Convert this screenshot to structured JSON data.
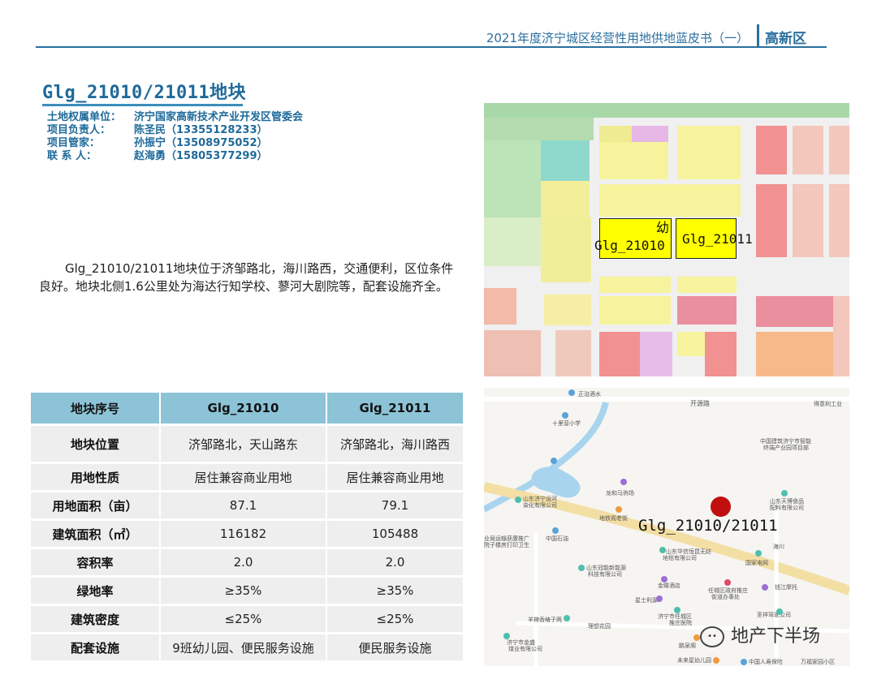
{
  "header": {
    "title": "2021年度济宁城区经营性用地供地蓝皮书（一）",
    "zone": "高新区"
  },
  "plot_title": "Glg_21010/21011地块",
  "contacts": [
    {
      "label": "土地权属单位：",
      "value": "济宁国家高新技术产业开发区管委会"
    },
    {
      "label": "项目负责人：",
      "value": "陈圣民（13355128233）"
    },
    {
      "label": "项目管家：",
      "value": "孙振宁（13508975052）"
    },
    {
      "label": "联 系 人：",
      "value": "赵海勇（15805377299）"
    }
  ],
  "description": "Glg_21010/21011地块位于济邹路北，海川路西，交通便利，区位条件良好。地块北侧1.6公里处为海达行知学校、蓼河大剧院等，配套设施齐全。",
  "table": {
    "headers": [
      "地块序号",
      "Glg_21010",
      "Glg_21011"
    ],
    "rows": [
      [
        "地块位置",
        "济邹路北，天山路东",
        "济邹路北，海川路西"
      ],
      [
        "用地性质",
        "居住兼容商业用地",
        "居住兼容商业用地"
      ],
      [
        "用地面积（亩）",
        "87.1",
        "79.1"
      ],
      [
        "建筑面积（㎡）",
        "116182",
        "105488"
      ],
      [
        "容积率",
        "2.0",
        "2.0"
      ],
      [
        "绿地率",
        "≥35%",
        "≥35%"
      ],
      [
        "建筑密度",
        "≤25%",
        "≤25%"
      ],
      [
        "配套设施",
        "9班幼儿园、便民服务设施",
        "便民服务设施"
      ]
    ]
  },
  "planning_map": {
    "label_a": "Glg_21010",
    "label_b": "Glg_21011",
    "label_kinder": "幼"
  },
  "location_map": {
    "plot_label": "Glg_21010/21011",
    "pois": [
      "正治酒水",
      "开源路",
      "得意利工业",
      "十里营小学",
      "中国建筑济宁市智能",
      "终端产业园项目部",
      "龙和马驹场",
      "山东济宁运河",
      "染化有限公司",
      "山东天博食品",
      "配料有限公司",
      "地铁观老街",
      "中国石油",
      "业局运输获康推广",
      "院子楼房打印卫生",
      "山东华信恒昆无纺",
      "地毯有限公司",
      "国家电网",
      "山东冠能新能源",
      "科技有限公司",
      "金蝶酒店",
      "任城区政府推庄",
      "街道办事处",
      "钱江摩托",
      "星士利源",
      "济宁市任城区",
      "推庄医院",
      "圣祥驾驶公司",
      "羊辣香椿子两",
      "理想花园",
      "济宁市金盛",
      "煤业有限公司",
      "鹏泉阁",
      "未来星幼儿园",
      "中国人寿保险",
      "万福家园小区",
      "海川"
    ]
  },
  "watermark": "地产下半场",
  "colors": {
    "brand_blue": "#2a6f9e",
    "table_header": "#8cc3d6",
    "table_cell": "#eeeeee",
    "marker_red": "#c00f0f",
    "plot_yellow": "#ffff00"
  }
}
